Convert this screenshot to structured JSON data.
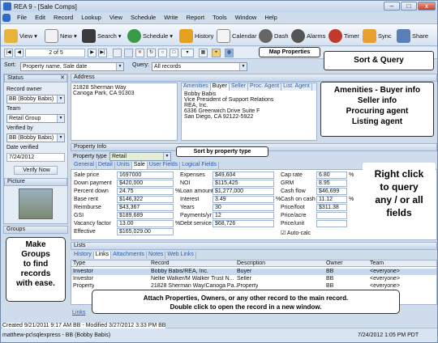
{
  "window": {
    "title": "REA 9 - [Sale Comps]",
    "minimize": "–",
    "maximize": "□",
    "close": "x"
  },
  "menu": [
    "File",
    "Edit",
    "Record",
    "Lookup",
    "View",
    "Schedule",
    "Write",
    "Report",
    "Tools",
    "Window",
    "Help"
  ],
  "toolbar": {
    "view": "View",
    "new": "New",
    "search": "Search",
    "schedule": "Schedule",
    "history": "History",
    "calendar": "Calendar",
    "dash": "Dash",
    "alarms": "Alarms",
    "timer": "Timer",
    "sync": "Sync",
    "share": "Share"
  },
  "navigator": {
    "position": "2 of 5",
    "first": "|◀",
    "prev": "◀",
    "next": "▶",
    "last": "▶|"
  },
  "sort": {
    "label": "Sort:",
    "value": "Property name, Sale date",
    "query_label": "Query:",
    "query_value": "All records"
  },
  "callouts": {
    "map": "Map Properties",
    "sort_query": "Sort & Query",
    "amenities": "Amenities - Buyer info\nSeller info\nProcuring agent\nListing agent",
    "sort_type": "Sort by property type",
    "right_click": "Right click\nto query\nany / or all\nfields",
    "groups": "Make\nGroups\nto find\nrecords\nwith ease.",
    "attach_1": "Attach Properties, Owners, or any other record to the main record.",
    "attach_2": "Double click to open the record in a new window."
  },
  "status": {
    "header": "Status",
    "record_owner_label": "Record owner",
    "record_owner": "BB (Bobby Babis)",
    "team_label": "Team",
    "team": "Retail Group",
    "verified_by_label": "Verified by",
    "verified_by": "BB (Bobby Babis)",
    "date_verified_label": "Date verified",
    "date_verified": "7/24/2012",
    "verify_button": "Verify Now",
    "picture": "Picture",
    "groups": "Groups"
  },
  "address": {
    "header": "Address",
    "text": "21828 Sherman Way\nCanoga Park, CA 91303"
  },
  "buyer_tabs": [
    "Amenities",
    "Buyer",
    "Seller",
    "Proc. Agent",
    "List. Agent"
  ],
  "buyer": {
    "text": "Bobby Babis\nVice President of Support Relations\nREA, Inc.\n6336 Greenwich Drive Suite F\nSan Diego, CA 92122-5922"
  },
  "property_info": {
    "header": "Property Info",
    "type_label": "Property type",
    "type": "Retail"
  },
  "info_tabs": [
    "General",
    "Detail",
    "Units",
    "Sale",
    "User Fields",
    "Logical Fields"
  ],
  "sale_fields": {
    "col1": [
      {
        "l": "Sale price",
        "v": "1697000"
      },
      {
        "l": "Down payment",
        "v": "$420,000"
      },
      {
        "l": "Percent down",
        "v": "24.75",
        "u": "%"
      },
      {
        "l": "Base rent",
        "v": "$146,322"
      },
      {
        "l": "Reimburse",
        "v": "$43,367"
      },
      {
        "l": "GSI",
        "v": "$189,689"
      },
      {
        "l": "Vacancy factor",
        "v": "13.00",
        "u": "%"
      },
      {
        "l": "Effective",
        "v": "$165,029.00"
      }
    ],
    "col2": [
      {
        "l": "Expenses",
        "v": "$49,604"
      },
      {
        "l": "NOI",
        "v": "$115,425"
      },
      {
        "l": "Loan amount",
        "v": "$1,277,000"
      },
      {
        "l": "Interest",
        "v": "3.49",
        "u": "%"
      },
      {
        "l": "Years",
        "v": "30"
      },
      {
        "l": "Payments/yr",
        "v": "12"
      },
      {
        "l": "Debt service",
        "v": "$68,726"
      }
    ],
    "col3": [
      {
        "l": "Cap rate",
        "v": "6.80",
        "u": "%"
      },
      {
        "l": "GRM",
        "v": "8.95"
      },
      {
        "l": "Cash flow",
        "v": "$46,699"
      },
      {
        "l": "Cash on cash",
        "v": "11.12",
        "u": "%"
      },
      {
        "l": "Price/foot",
        "v": "$311.38"
      },
      {
        "l": "Price/acre",
        "v": ""
      },
      {
        "l": "Price/unit",
        "v": ""
      }
    ],
    "autocalc": "Auto-calc"
  },
  "lists": {
    "header": "Lists",
    "tabs": [
      "History",
      "Links",
      "Attachments",
      "Notes",
      "Web Links"
    ],
    "columns": [
      "Type",
      "Record",
      "Description",
      "Owner",
      "Team"
    ],
    "rows": [
      [
        "Investor",
        "Bobby Babis/REA, Inc.",
        "Buyer",
        "BB",
        "<everyone>"
      ],
      [
        "Investor",
        "Nellie Walker/M Walker Trust N...",
        "Seller",
        "BB",
        "<everyone>"
      ],
      [
        "Property",
        "21828 Sherman Way/Canoga Pa...",
        "Property",
        "BB",
        "<everyone>"
      ]
    ],
    "links_tab": "Links"
  },
  "statusbar": {
    "created": "Created 9/21/2011 9:17 AM BB - Modified 3/27/2012 3:33 PM BB",
    "server": "matthew-pc\\sqlexpress - BB (Bobby Babis)",
    "datetime": "7/24/2012 1:05 PM PDT"
  }
}
